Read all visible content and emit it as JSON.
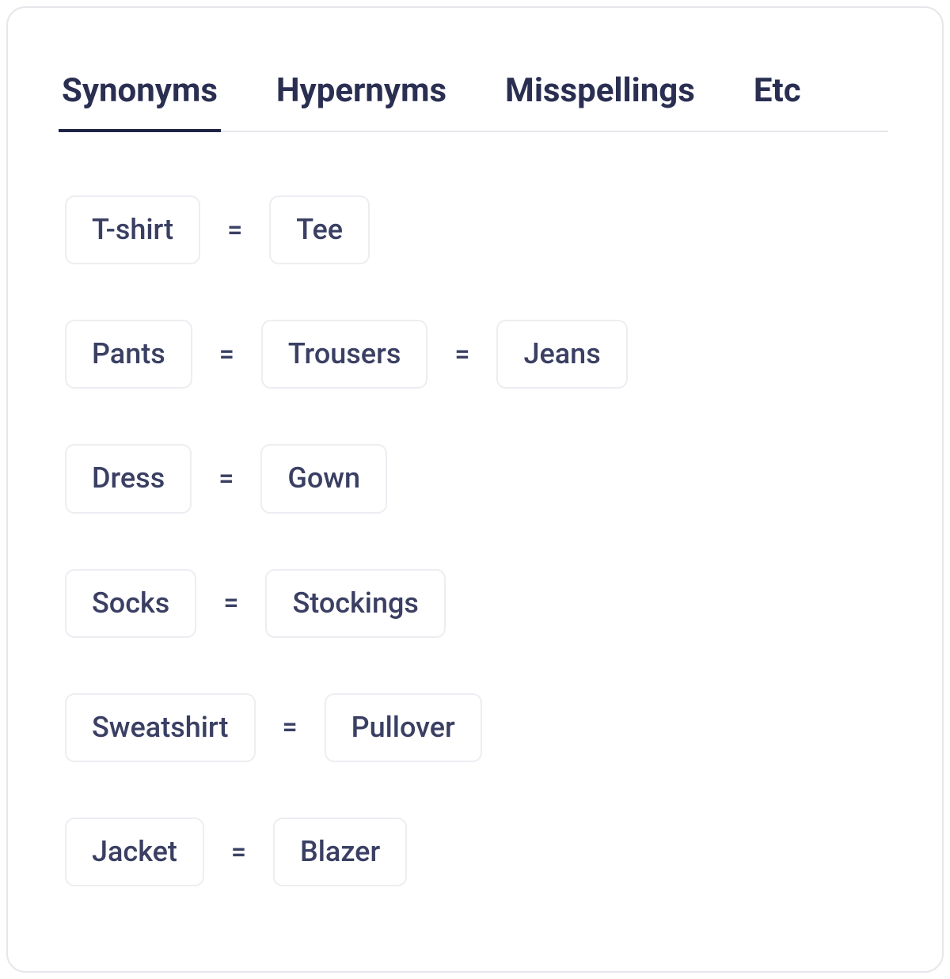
{
  "tabs": [
    {
      "label": "Synonyms",
      "active": true
    },
    {
      "label": "Hypernyms",
      "active": false
    },
    {
      "label": "Misspellings",
      "active": false
    },
    {
      "label": "Etc",
      "active": false
    }
  ],
  "equals_symbol": "=",
  "synonym_rows": [
    [
      "T-shirt",
      "Tee"
    ],
    [
      "Pants",
      "Trousers",
      "Jeans"
    ],
    [
      "Dress",
      "Gown"
    ],
    [
      "Socks",
      "Stockings"
    ],
    [
      "Sweatshirt",
      "Pullover"
    ],
    [
      "Jacket",
      "Blazer"
    ]
  ]
}
